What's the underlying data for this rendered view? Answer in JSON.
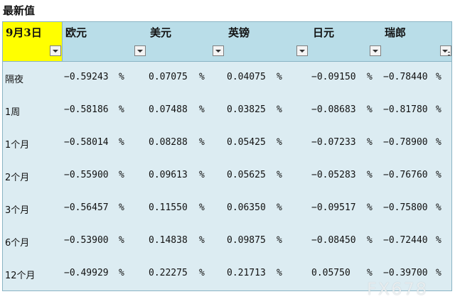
{
  "title": "最新值",
  "header": {
    "date": "9月3日",
    "columns": [
      "欧元",
      "美元",
      "英镑",
      "日元",
      "瑞郎"
    ]
  },
  "rows": [
    {
      "label": "隔夜",
      "values": [
        "−0.59243",
        "0.07075",
        "0.04075",
        "−0.09150",
        "−0.78440"
      ]
    },
    {
      "label": "1周",
      "values": [
        "−0.58186",
        "0.07488",
        "0.03825",
        "−0.08683",
        "−0.81780"
      ]
    },
    {
      "label": "1个月",
      "values": [
        "−0.58014",
        "0.08288",
        "0.05425",
        "−0.07233",
        "−0.78900"
      ]
    },
    {
      "label": "2个月",
      "values": [
        "−0.55900",
        "0.09613",
        "0.05625",
        "−0.05283",
        "−0.76760"
      ]
    },
    {
      "label": "3个月",
      "values": [
        "−0.56457",
        "0.11550",
        "0.06350",
        "−0.09517",
        "−0.75800"
      ]
    },
    {
      "label": "6个月",
      "values": [
        "−0.53900",
        "0.14838",
        "0.09875",
        "−0.08450",
        "−0.72440"
      ]
    },
    {
      "label": "12个月",
      "values": [
        "−0.49929",
        "0.22275",
        "0.21713",
        "0.05750",
        "−0.39700"
      ]
    }
  ],
  "percent_sign": "%",
  "watermark": "FX678",
  "icons": {
    "filter": "dropdown-arrow-icon",
    "filter_active": "filter-active-icon"
  }
}
